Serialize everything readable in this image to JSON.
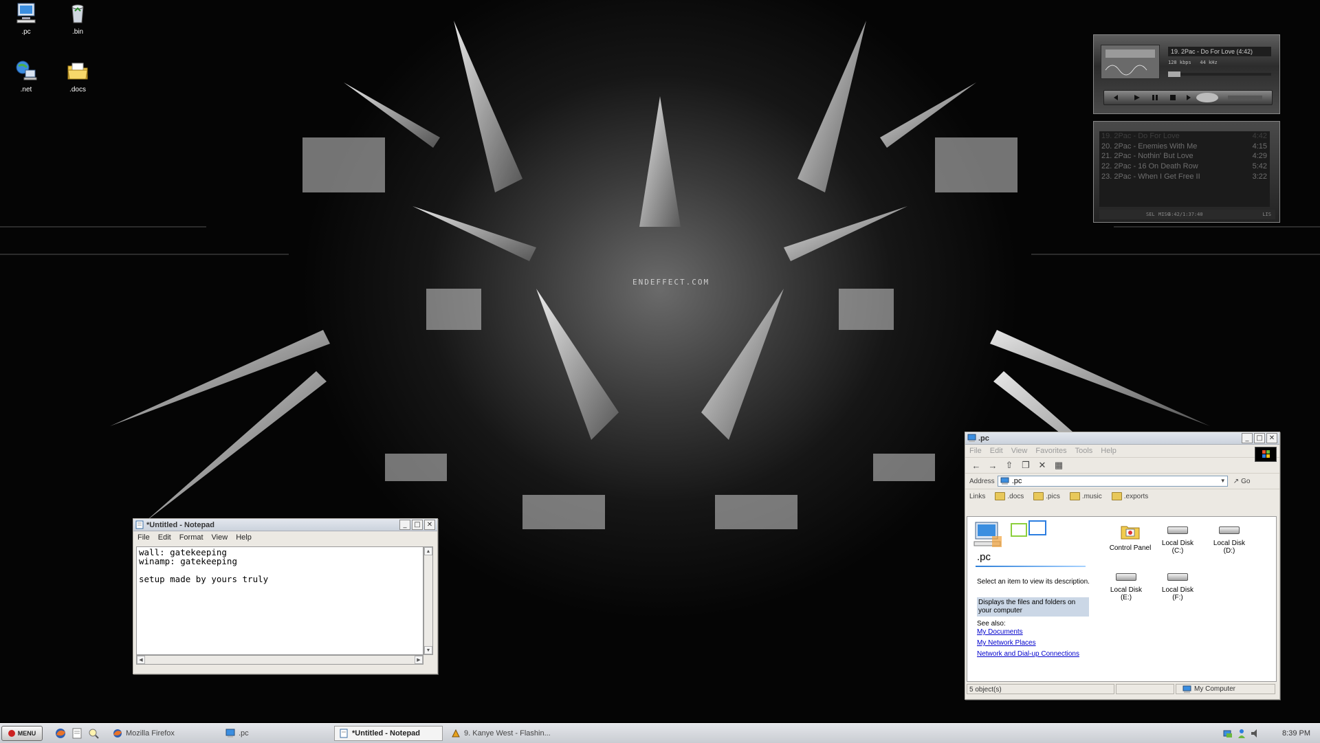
{
  "wallpaper": {
    "watermark": "ENDEFFECT.COM"
  },
  "desktop_icons": [
    {
      "label": ".pc",
      "icon": "computer-icon"
    },
    {
      "label": ".bin",
      "icon": "recycle-bin-icon"
    },
    {
      "label": ".net",
      "icon": "network-icon"
    },
    {
      "label": ".docs",
      "icon": "folder-icon"
    }
  ],
  "winamp": {
    "now_playing": "19. 2Pac - Do For Love (4:42)",
    "kbps": "128 kbps",
    "khz": "44 kHz",
    "playlist": [
      {
        "title": "19. 2Pac - Do For Love",
        "time": "4:42",
        "selected": true
      },
      {
        "title": "20. 2Pac - Enemies With Me",
        "time": "4:15",
        "selected": false
      },
      {
        "title": "21. 2Pac - Nothin' But Love",
        "time": "4:29",
        "selected": false
      },
      {
        "title": "22. 2Pac - 16 On Death Row",
        "time": "5:42",
        "selected": false
      },
      {
        "title": "23. 2Pac - When I Get Free II",
        "time": "3:22",
        "selected": false
      }
    ],
    "playlist_footer": "4:42/1:37:40",
    "footer_buttons": [
      "SEL",
      "MISC",
      "LIS"
    ]
  },
  "notepad": {
    "title": "*Untitled - Notepad",
    "menu": [
      "File",
      "Edit",
      "Format",
      "View",
      "Help"
    ],
    "content": "wall: gatekeeping\nwinamp: gatekeeping\n\nsetup made by yours truly\n"
  },
  "explorer": {
    "title": ".pc",
    "menu": [
      "File",
      "Edit",
      "View",
      "Favorites",
      "Tools",
      "Help"
    ],
    "address_label": "Address",
    "address_value": ".pc",
    "go_label": "Go",
    "links_label": "Links",
    "links": [
      ".docs",
      ".pics",
      ".music",
      ".exports"
    ],
    "panel_title": ".pc",
    "select_prompt": "Select an item to view its description.",
    "highlight_text": "Displays the files and folders on your computer",
    "see_also_label": "See also:",
    "see_also_links": [
      "My Documents",
      "My Network Places",
      "Network and Dial-up Connections"
    ],
    "items": [
      {
        "label": "Control Panel",
        "sub": ""
      },
      {
        "label": "Local Disk",
        "sub": "(C:)"
      },
      {
        "label": "Local Disk",
        "sub": "(D:)"
      },
      {
        "label": "Local Disk",
        "sub": "(E:)"
      },
      {
        "label": "Local Disk",
        "sub": "(F:)"
      }
    ],
    "status_count": "5 object(s)",
    "status_location": "My Computer"
  },
  "taskbar": {
    "start_label": "MENU",
    "tasks": [
      {
        "label": "Mozilla Firefox",
        "active": false
      },
      {
        "label": ".pc",
        "active": false
      },
      {
        "label": "*Untitled - Notepad",
        "active": true
      },
      {
        "label": "9. Kanye West - Flashin...",
        "active": false
      }
    ],
    "clock": "8:39 PM"
  }
}
